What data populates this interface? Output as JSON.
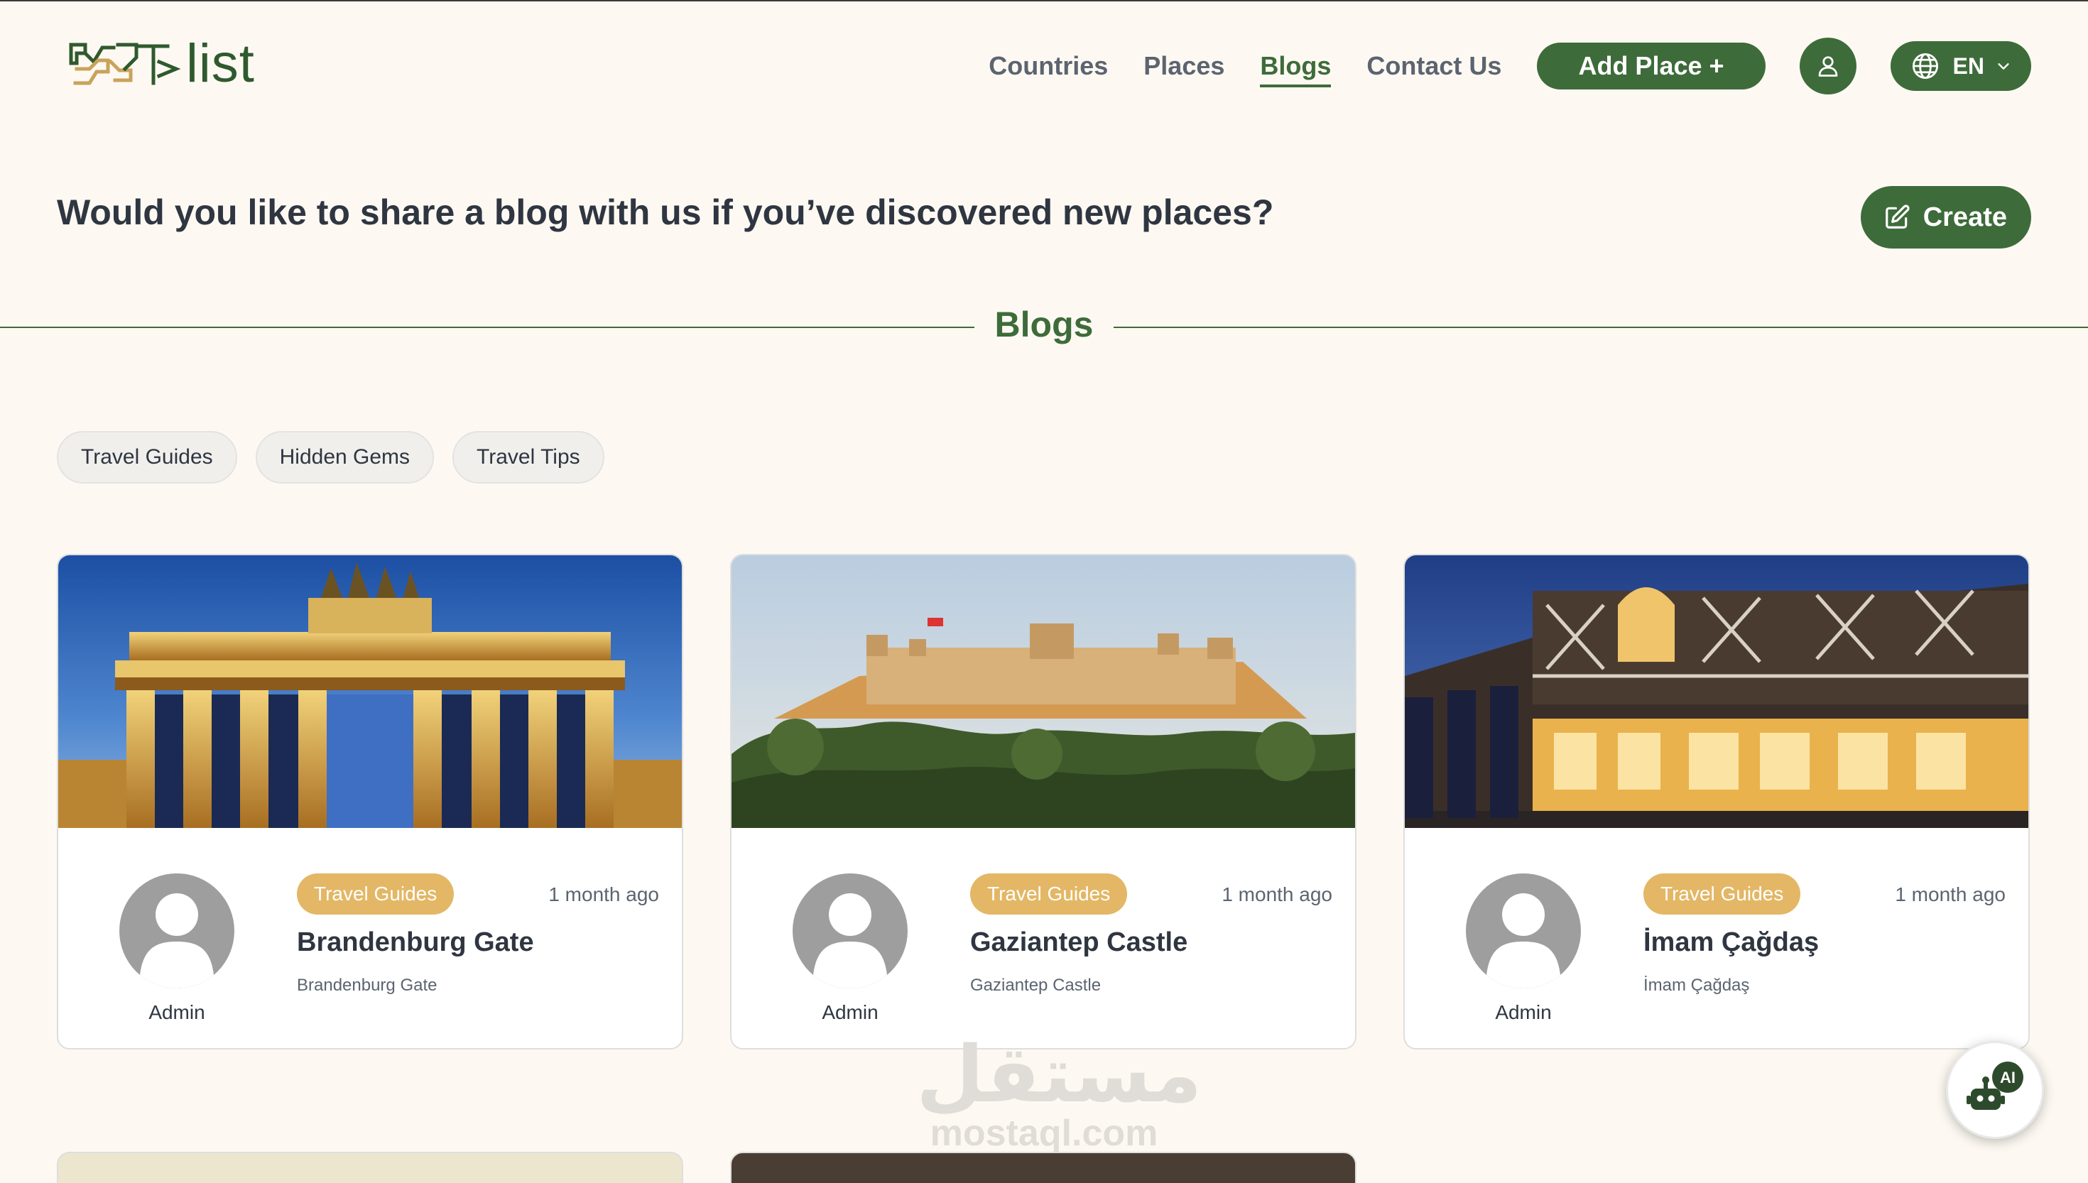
{
  "brand": {
    "logo_text": "list"
  },
  "nav": {
    "links": [
      "Countries",
      "Places",
      "Blogs",
      "Contact Us"
    ],
    "active": "Blogs",
    "add_place": "Add Place +",
    "language": "EN"
  },
  "hero": {
    "question": "Would you like to share a blog with us if you’ve discovered new places?",
    "create": "Create"
  },
  "section": {
    "title": "Blogs"
  },
  "filters": [
    "Travel Guides",
    "Hidden Gems",
    "Travel Tips"
  ],
  "blogs": [
    {
      "author": "Admin",
      "category": "Travel Guides",
      "time": "1 month ago",
      "title": "Brandenburg Gate",
      "subtitle": "Brandenburg Gate",
      "image": "brandenburg-gate-photo"
    },
    {
      "author": "Admin",
      "category": "Travel Guides",
      "time": "1 month ago",
      "title": "Gaziantep Castle",
      "subtitle": "Gaziantep Castle",
      "image": "gaziantep-castle-photo"
    },
    {
      "author": "Admin",
      "category": "Travel Guides",
      "time": "1 month ago",
      "title": "İmam Çağdaş",
      "subtitle": "İmam Çağdaş",
      "image": "imam-cagdas-photo"
    }
  ],
  "watermark": {
    "arabic": "مستقل",
    "latin": "mostaql.com"
  },
  "assistant": {
    "badge": "AI"
  },
  "colors": {
    "primary": "#3e6b3a",
    "badge": "#e3b765",
    "background": "#fdf9f2",
    "text": "#2f3641"
  }
}
